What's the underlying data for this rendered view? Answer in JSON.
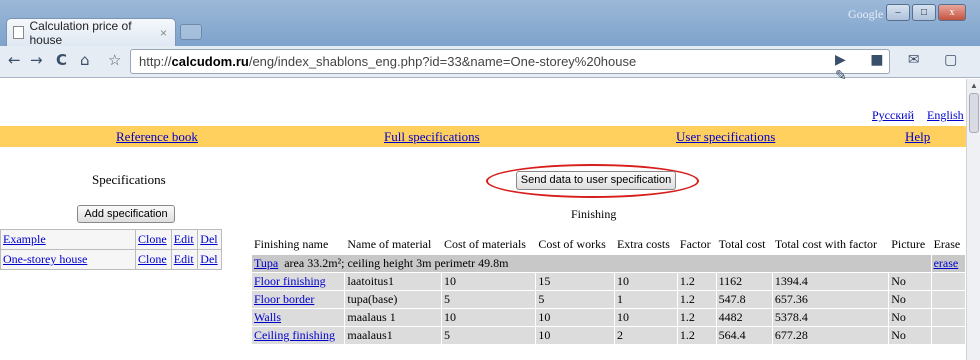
{
  "browser": {
    "tab_title": "Calculation price of house",
    "tab_close": "×",
    "brand": "Google",
    "url_prefix": "http://",
    "url_domain": "calcudom.ru",
    "url_path": "/eng/index_shablons_eng.php?id=33&name=One-storey%20house",
    "back": "←",
    "forward": "→",
    "reload": "C",
    "home": "⌂",
    "star": "☆",
    "win_min": "–",
    "win_max": "□",
    "win_close": "x"
  },
  "lang": {
    "ru": "Русский",
    "en": "English"
  },
  "menu": {
    "reference": "Reference book",
    "full": "Full specifications",
    "user": "User specifications",
    "help": "Help"
  },
  "left": {
    "title": "Specifications",
    "add_button": "Add specification",
    "items": [
      {
        "name": "Example",
        "clone": "Clone",
        "edit": "Edit",
        "del": "Del"
      },
      {
        "name": "One-storey house",
        "clone": "Clone",
        "edit": "Edit",
        "del": "Del"
      }
    ]
  },
  "main": {
    "send_button": "Send data to user specification",
    "section_title": "Finishing",
    "headers": [
      "Finishing name",
      "Name of material",
      "Cost of materials",
      "Cost of works",
      "Extra costs",
      "Factor",
      "Total cost",
      "Total cost with factor",
      "Picture",
      "Erase"
    ],
    "area_row": {
      "link": "Tupa",
      "text": "area  33.2m²;  ceiling height  3m  perimetr  49.8m",
      "erase": "erase"
    },
    "rows": [
      [
        "Floor finishing",
        "laatoitus1",
        "10",
        "15",
        "10",
        "1.2",
        "1162",
        "1394.4",
        "No"
      ],
      [
        "Floor border",
        "tupa(base)",
        "5",
        "5",
        "1",
        "1.2",
        "547.8",
        "657.36",
        "No"
      ],
      [
        "Walls",
        "maalaus 1",
        "10",
        "10",
        "10",
        "1.2",
        "4482",
        "5378.4",
        "No"
      ],
      [
        "Ceiling finishing",
        "maalaus1",
        "5",
        "10",
        "2",
        "1.2",
        "564.4",
        "677.28",
        "No"
      ]
    ]
  },
  "colors": {
    "menubar": "#ffd05e",
    "highlight": "#d81d1d",
    "link": "#0000cc"
  }
}
